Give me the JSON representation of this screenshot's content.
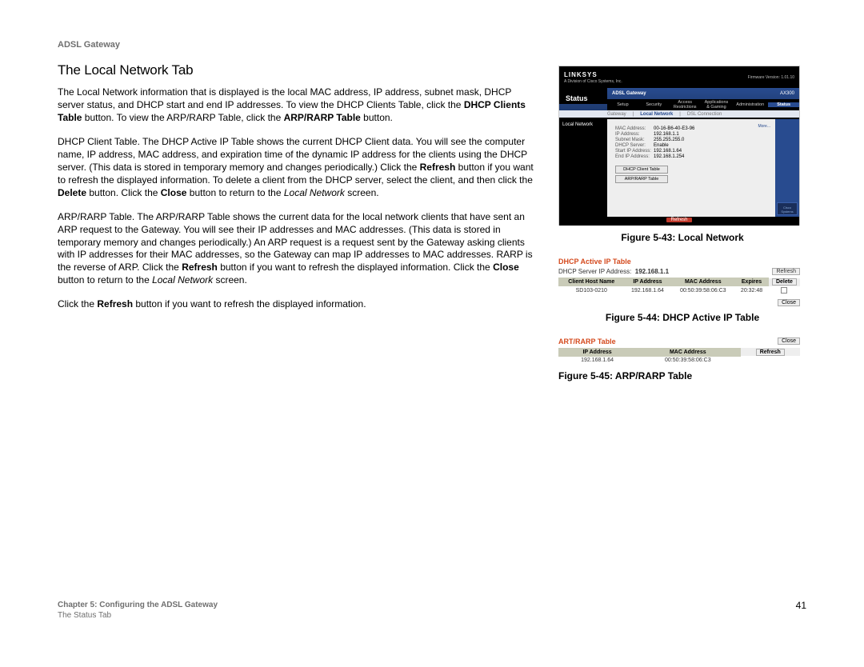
{
  "header": {
    "gateway": "ADSL Gateway"
  },
  "section": {
    "heading": "The Local Network Tab"
  },
  "para": {
    "p1_a": "The Local Network information that is displayed is the local MAC address, IP address, subnet mask, DHCP server status, and DHCP start and end IP addresses. To view the DHCP Clients Table, click the ",
    "p1_b": "DHCP Clients Table",
    "p1_c": " button. To view the ARP/RARP Table, click the ",
    "p1_d": "ARP/RARP Table",
    "p1_e": " button.",
    "p2_a": "DHCP Client Table. The DHCP Active IP Table shows the current DHCP Client data. You will see the computer name, IP address, MAC address, and expiration time of the dynamic IP address for the clients using the DHCP server. (This data is stored in temporary memory and changes periodically.) Click the ",
    "p2_b": "Refresh",
    "p2_c": " button if you want to refresh the displayed information. To delete a client from the DHCP server, select the client, and then click the ",
    "p2_d": "Delete",
    "p2_e": " button. Click the ",
    "p2_f": "Close",
    "p2_g": " button to return to the ",
    "p2_h": "Local Network",
    "p2_i": " screen.",
    "p3_a": "ARP/RARP Table. The ARP/RARP Table shows the current data for the local network clients that have sent an ARP request to the Gateway. You will see their IP addresses and MAC addresses. (This data is stored in temporary memory and changes periodically.) An ARP request is a request sent by the Gateway asking clients with IP addresses for their MAC addresses, so the Gateway can map IP addresses to MAC addresses. RARP is the reverse of ARP. Click the ",
    "p3_b": "Refresh",
    "p3_c": " button if you want to refresh the displayed information. Click the ",
    "p3_d": "Close",
    "p3_e": " button to return to the ",
    "p3_f": "Local Network",
    "p3_g": " screen.",
    "p4_a": "Click the ",
    "p4_b": "Refresh",
    "p4_c": " button if you want to refresh the displayed information."
  },
  "captions": {
    "fig43": "Figure 5-43: Local Network",
    "fig44": "Figure 5-44: DHCP Active IP Table",
    "fig45": "Figure 5-45: ARP/RARP Table"
  },
  "router": {
    "brand": "LINKSYS",
    "brand_tag": "A Division of Cisco Systems, Inc.",
    "fw": "Firmware Version: 1.01.10",
    "product": "ADSL Gateway",
    "model": "AX300",
    "status_tab": "Status",
    "tabs": {
      "setup": "Setup",
      "security": "Security",
      "access": "Access Restrictions",
      "apps": "Applications & Gaming",
      "admin": "Administration",
      "status": "Status"
    },
    "subtabs": {
      "gateway": "Gateway",
      "local": "Local Network",
      "dsl": "DSL Connection"
    },
    "side_label": "Local Network",
    "more": "More...",
    "fields": {
      "mac_lbl": "MAC Address:",
      "mac_val": "00-16-B6-40-E3-96",
      "ip_lbl": "IP Address:",
      "ip_val": "192.168.1.1",
      "subnet_lbl": "Subnet Mask:",
      "subnet_val": "255.255.255.0",
      "dhcp_lbl": "DHCP Server:",
      "dhcp_val": "Enable",
      "start_lbl": "Start IP Address:",
      "start_val": "192.168.1.64",
      "end_lbl": "End IP Address:",
      "end_val": "192.168.1.254"
    },
    "buttons": {
      "dhcp": "DHCP Client Table",
      "arp": "ARP/RARP Table"
    },
    "refresh": "Refresh",
    "cisco": "Cisco Systems"
  },
  "dhcp_table": {
    "title": "DHCP Active IP Table",
    "server_lbl": "DHCP Server IP Address:",
    "server_ip": "192.168.1.1",
    "refresh": "Refresh",
    "delete": "Delete",
    "close": "Close",
    "headers": {
      "host": "Client Host Name",
      "ip": "IP Address",
      "mac": "MAC Address",
      "exp": "Expires"
    },
    "row": {
      "host": "SD103-0210",
      "ip": "192.168.1.64",
      "mac": "00:50:39:58:06:C3",
      "exp": "20:32:48"
    }
  },
  "arp_table": {
    "title": "ART/RARP Table",
    "close": "Close",
    "refresh": "Refresh",
    "headers": {
      "ip": "IP Address",
      "mac": "MAC Address"
    },
    "row": {
      "ip": "192.168.1.64",
      "mac": "00:50:39:58:06:C3"
    }
  },
  "footer": {
    "chapter": "Chapter 5: Configuring the ADSL Gateway",
    "sub": "The Status Tab",
    "page": "41"
  }
}
